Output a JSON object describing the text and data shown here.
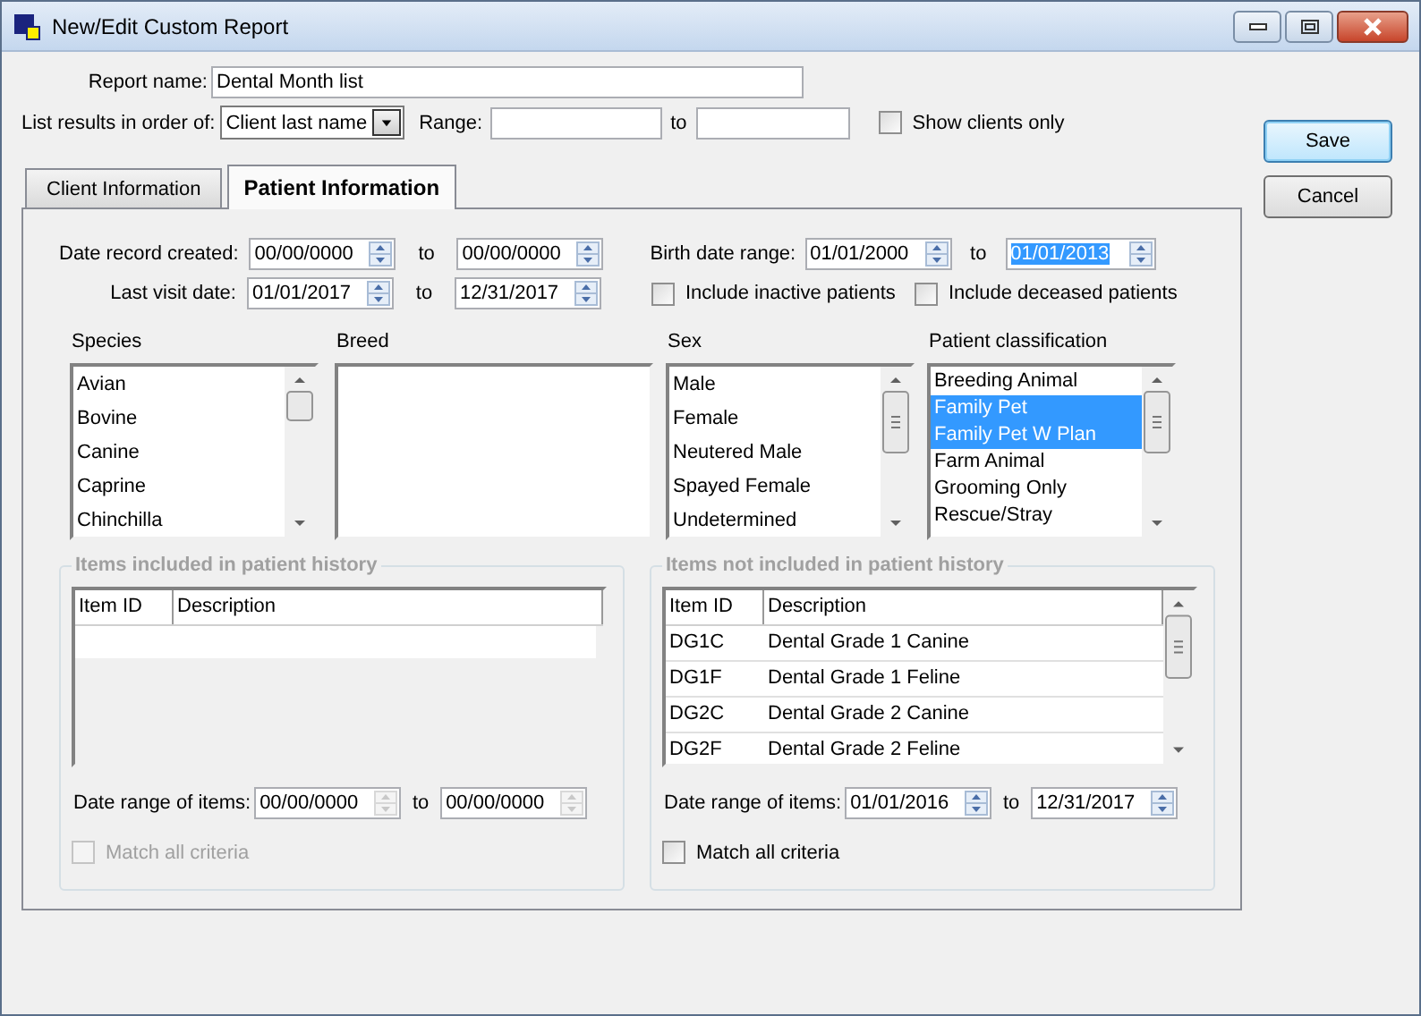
{
  "window": {
    "title": "New/Edit Custom Report"
  },
  "report_name": {
    "label": "Report name:",
    "value": "Dental Month list"
  },
  "order": {
    "label": "List results in order of:",
    "value": "Client last name"
  },
  "range": {
    "label": "Range:",
    "to_label": "to"
  },
  "show_clients_only": {
    "label": "Show clients only",
    "checked": false
  },
  "buttons": [
    {
      "label": "Save",
      "kind": "default"
    },
    {
      "label": "Cancel",
      "kind": "normal"
    }
  ],
  "tabs": [
    {
      "label": "Client Information",
      "selected": false
    },
    {
      "label": "Patient Information",
      "selected": true
    }
  ],
  "date_rows": [
    {
      "label": "Date record created:",
      "from": "00/00/0000",
      "to_label": "to",
      "to": "00/00/0000"
    },
    {
      "label": "Last visit date:",
      "from": "01/01/2017",
      "to_label": "to",
      "to": "12/31/2017"
    }
  ],
  "birth_date_range": {
    "label": "Birth date range:",
    "from": "01/01/2000",
    "to_label": "to",
    "to": "01/01/2013",
    "to_selected": true
  },
  "options": [
    {
      "label": "Include inactive patients",
      "checked": false
    },
    {
      "label": "Include deceased patients",
      "checked": false
    }
  ],
  "lists": [
    {
      "label": "Species",
      "items": [
        {
          "text": "Avian",
          "selected": false
        },
        {
          "text": "Bovine",
          "selected": false
        },
        {
          "text": "Canine",
          "selected": false
        },
        {
          "text": "Caprine",
          "selected": false
        },
        {
          "text": "Chinchilla",
          "selected": false
        }
      ]
    },
    {
      "label": "Breed"
    },
    {
      "label": "Sex",
      "items": [
        {
          "text": "Male",
          "selected": false
        },
        {
          "text": "Female",
          "selected": false
        },
        {
          "text": "Neutered Male",
          "selected": false
        },
        {
          "text": "Spayed Female",
          "selected": false
        },
        {
          "text": "Undetermined",
          "selected": false
        }
      ]
    },
    {
      "label": "Patient classification",
      "items": [
        {
          "text": "Breeding Animal",
          "selected": false
        },
        {
          "text": "Family Pet",
          "selected": true
        },
        {
          "text": "Family Pet W Plan",
          "selected": true
        },
        {
          "text": "Farm Animal",
          "selected": false
        },
        {
          "text": "Grooming Only",
          "selected": false
        },
        {
          "text": "Rescue/Stray",
          "selected": false
        }
      ]
    }
  ],
  "history_groups": [
    {
      "title": "Items included in patient history",
      "disabled": true,
      "columns": [
        "Item ID",
        "Description"
      ],
      "date_range": {
        "label": "Date range of items:",
        "from": "00/00/0000",
        "to_label": "to",
        "to": "00/00/0000"
      },
      "match_all": {
        "label": "Match all criteria",
        "checked": false
      }
    },
    {
      "title": "Items not included in patient history",
      "disabled": false,
      "columns": [
        "Item ID",
        "Description"
      ],
      "rows": [
        [
          "DG1C",
          "Dental Grade 1 Canine"
        ],
        [
          "DG1F",
          "Dental Grade 1 Feline"
        ],
        [
          "DG2C",
          "Dental Grade 2 Canine"
        ],
        [
          "DG2F",
          "Dental Grade 2 Feline"
        ]
      ],
      "date_range": {
        "label": "Date range of items:",
        "from": "01/01/2016",
        "to_label": "to",
        "to": "12/31/2017"
      },
      "match_all": {
        "label": "Match all criteria",
        "checked": false
      }
    }
  ]
}
